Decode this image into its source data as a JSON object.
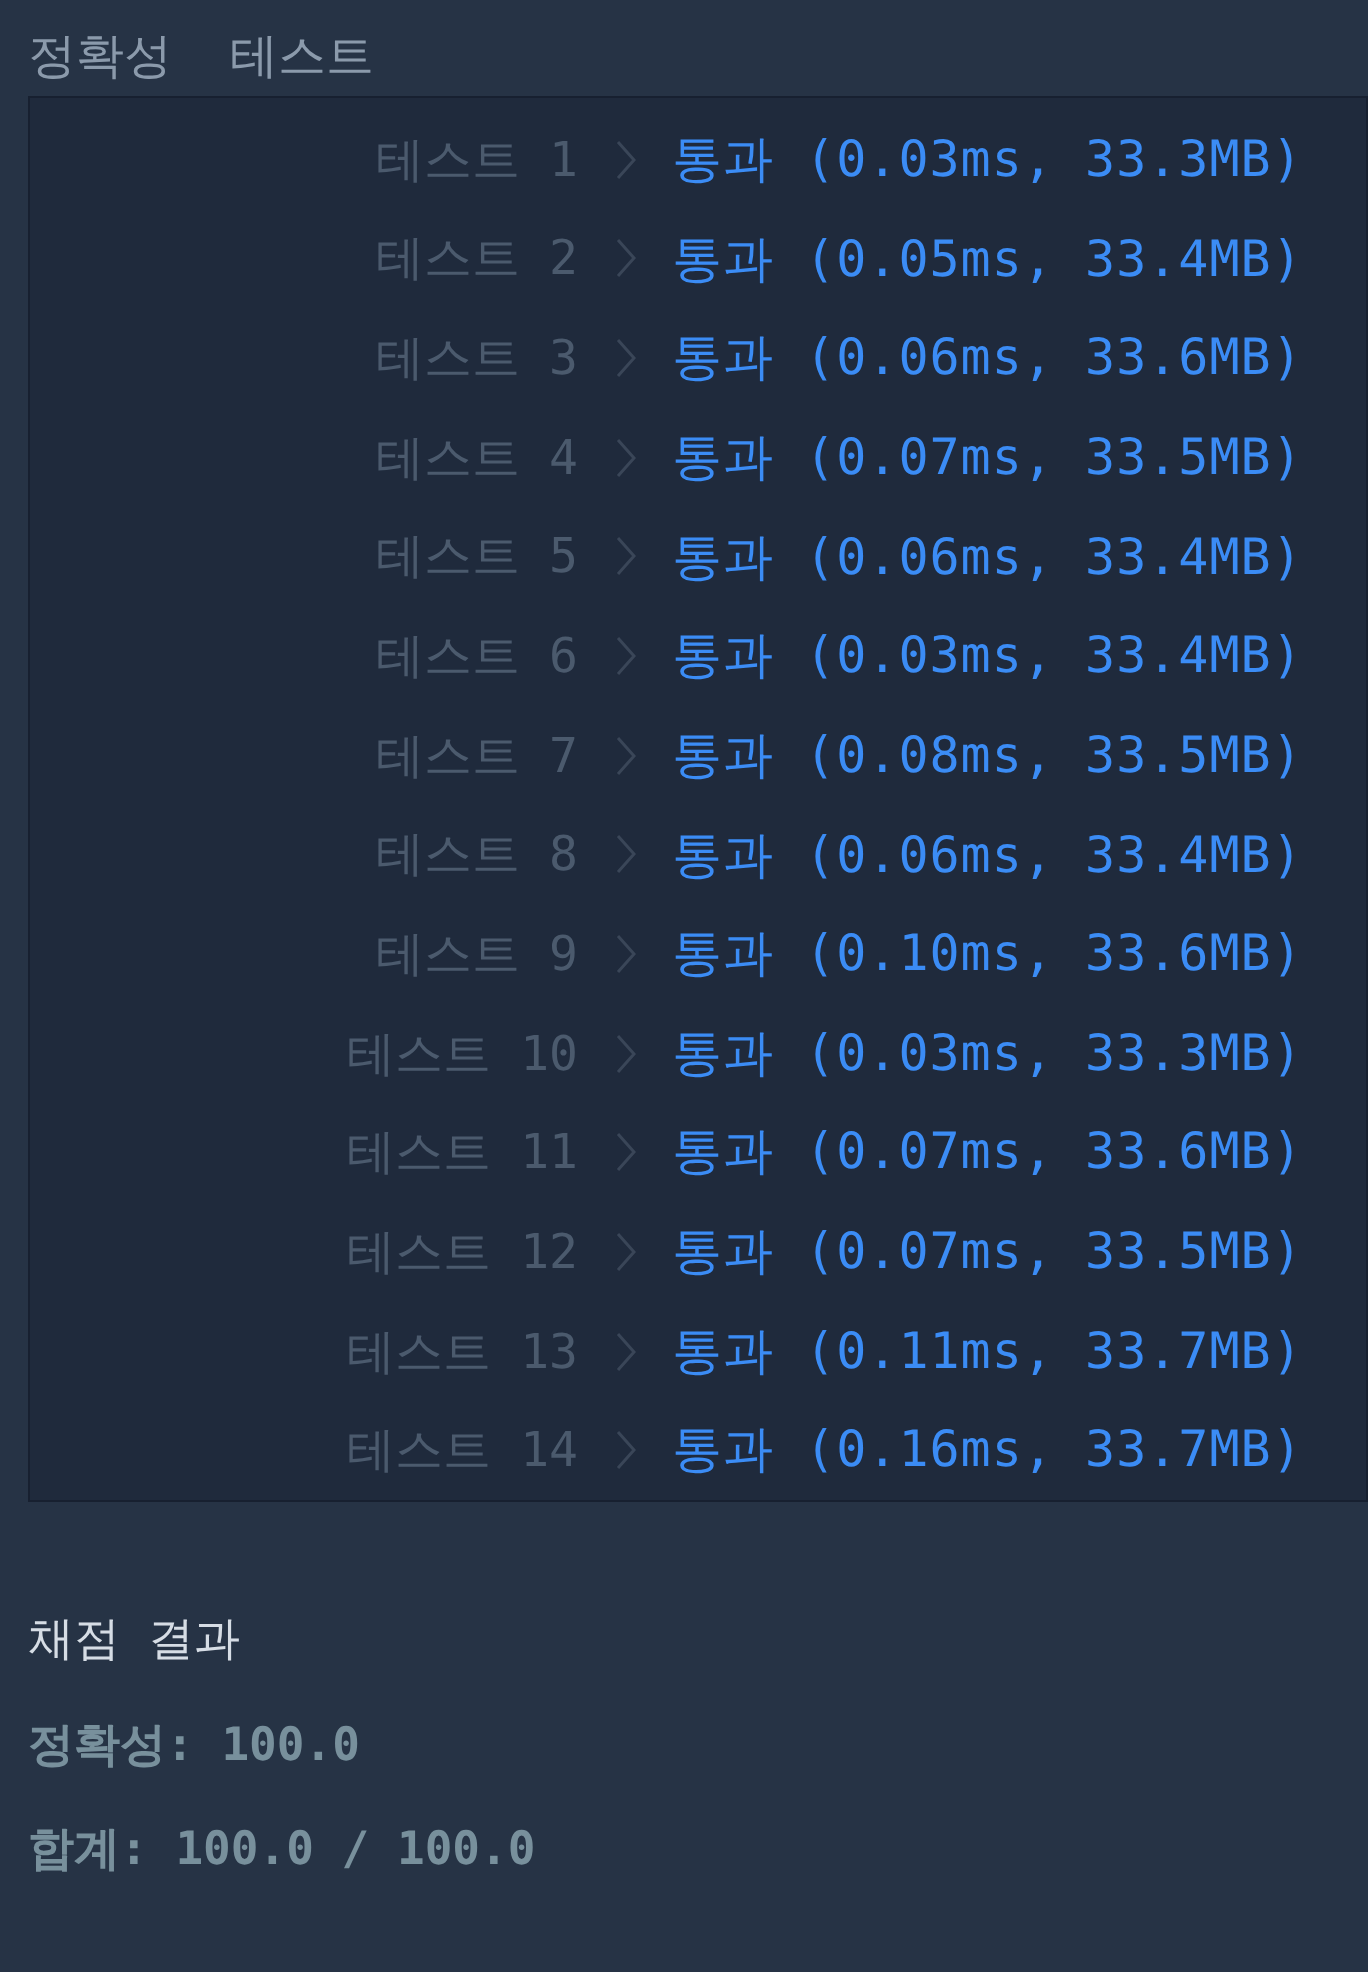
{
  "section_title": "정확성  테스트",
  "tests": [
    {
      "label": "테스트 1",
      "result": "통과 (0.03ms, 33.3MB)"
    },
    {
      "label": "테스트 2",
      "result": "통과 (0.05ms, 33.4MB)"
    },
    {
      "label": "테스트 3",
      "result": "통과 (0.06ms, 33.6MB)"
    },
    {
      "label": "테스트 4",
      "result": "통과 (0.07ms, 33.5MB)"
    },
    {
      "label": "테스트 5",
      "result": "통과 (0.06ms, 33.4MB)"
    },
    {
      "label": "테스트 6",
      "result": "통과 (0.03ms, 33.4MB)"
    },
    {
      "label": "테스트 7",
      "result": "통과 (0.08ms, 33.5MB)"
    },
    {
      "label": "테스트 8",
      "result": "통과 (0.06ms, 33.4MB)"
    },
    {
      "label": "테스트 9",
      "result": "통과 (0.10ms, 33.6MB)"
    },
    {
      "label": "테스트 10",
      "result": "통과 (0.03ms, 33.3MB)"
    },
    {
      "label": "테스트 11",
      "result": "통과 (0.07ms, 33.6MB)"
    },
    {
      "label": "테스트 12",
      "result": "통과 (0.07ms, 33.5MB)"
    },
    {
      "label": "테스트 13",
      "result": "통과 (0.11ms, 33.7MB)"
    },
    {
      "label": "테스트 14",
      "result": "통과 (0.16ms, 33.7MB)"
    }
  ],
  "grading": {
    "title": "채점 결과",
    "lines": [
      "정확성: 100.0",
      "합계: 100.0 / 100.0"
    ]
  }
}
